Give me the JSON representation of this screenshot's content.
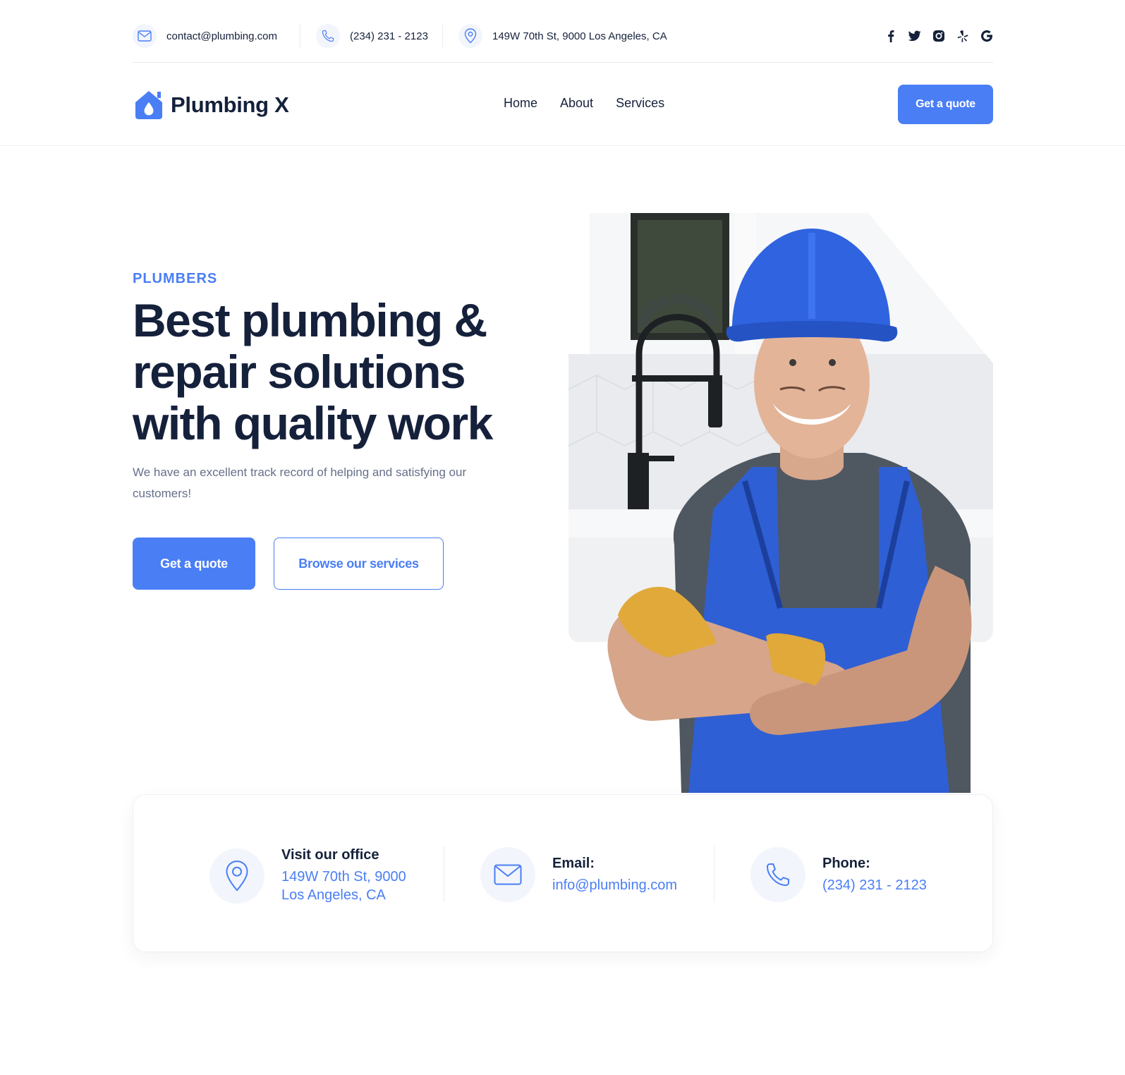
{
  "topbar": {
    "email": "contact@plumbing.com",
    "phone": "(234) 231 - 2123",
    "address": "149W 70th St, 9000 Los Angeles, CA",
    "socials": [
      "facebook-icon",
      "twitter-icon",
      "instagram-icon",
      "yelp-icon",
      "google-icon"
    ]
  },
  "header": {
    "logo_text": "Plumbing X",
    "nav": [
      "Home",
      "About",
      "Services"
    ],
    "cta": "Get a quote"
  },
  "hero": {
    "eyebrow": "PLUMBERS",
    "title_line1": "Best plumbing &",
    "title_line2": "repair solutions",
    "title_line3": "with quality work",
    "subtitle": "We have an excellent track record of helping and satisfying our customers!",
    "primary_button": "Get a quote",
    "secondary_button": "Browse our services"
  },
  "contact_card": {
    "office": {
      "label": "Visit our office",
      "line1": "149W 70th St, 9000",
      "line2": "Los Angeles, CA"
    },
    "email": {
      "label": "Email:",
      "value": "info@plumbing.com"
    },
    "phone": {
      "label": "Phone:",
      "value": "(234) 231 - 2123"
    }
  },
  "colors": {
    "accent": "#4a7ef5",
    "text_dark": "#15213b",
    "text_muted": "#66708a",
    "icon_bg": "#f2f5fc"
  }
}
